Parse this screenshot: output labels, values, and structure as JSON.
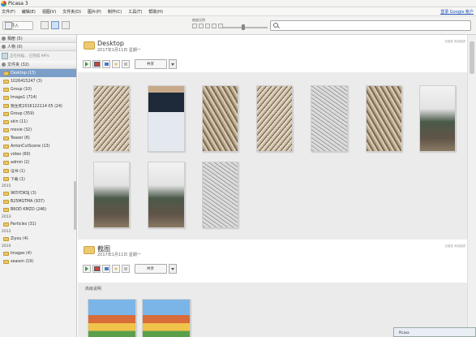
{
  "window": {
    "title": "Picasa 3"
  },
  "menu": {
    "items": [
      "文件(F)",
      "编辑(E)",
      "视图(V)",
      "文件夹(D)",
      "图片(P)",
      "制作(C)",
      "工具(T)",
      "帮助(H)"
    ],
    "account_link": "登录 Google 帐户"
  },
  "toolbar": {
    "import_label": "导入",
    "slider_label": "缩放比例",
    "zoom_level": 0.45
  },
  "sidebar": {
    "groups": [
      {
        "label": "相册 (5)"
      },
      {
        "label": "人物 (0)"
      }
    ],
    "scan_info": "正在扫描... 已完成 99%",
    "folders_header": "文件夹 (32)",
    "folders": [
      {
        "label": "Desktop (15)",
        "selected": true
      },
      {
        "label": "1026415247 (3)"
      },
      {
        "label": "Group (10)"
      },
      {
        "label": "Image1 (714)"
      },
      {
        "label": "我生死2016122114 05 (24)"
      },
      {
        "label": "Group (359)"
      },
      {
        "label": "skin (11)"
      },
      {
        "label": "movie (32)"
      },
      {
        "label": "Teaser (6)"
      },
      {
        "label": "AntonCutScene (13)"
      },
      {
        "label": "video (60)"
      },
      {
        "label": "admin (2)"
      },
      {
        "label": "证书 (1)"
      },
      {
        "label": "下载 (1)"
      }
    ],
    "years": [
      {
        "year": "2015",
        "folders": [
          "965YDKSJ (3)",
          "B25MGTMA (937)",
          "B6OD KMZO (246)"
        ]
      },
      {
        "year": "2013",
        "folders": [
          "Particles (31)"
        ]
      },
      {
        "year": "2012",
        "folders": [
          "Ziyou (4)"
        ]
      },
      {
        "year": "2010",
        "folders": [
          "Images (4)",
          "season (19)"
        ]
      }
    ]
  },
  "albums": [
    {
      "title": "Desktop",
      "date": "2017年1月11日 星期一",
      "share_label": "共享",
      "side_text": "无描述 添加描述"
    },
    {
      "title": "截图",
      "date": "2017年1月11日 星期一",
      "share_label": "共享",
      "side_text": "无描述 添加描述",
      "section_note": "高级说明"
    }
  ],
  "popup": {
    "text": "Picasa"
  }
}
